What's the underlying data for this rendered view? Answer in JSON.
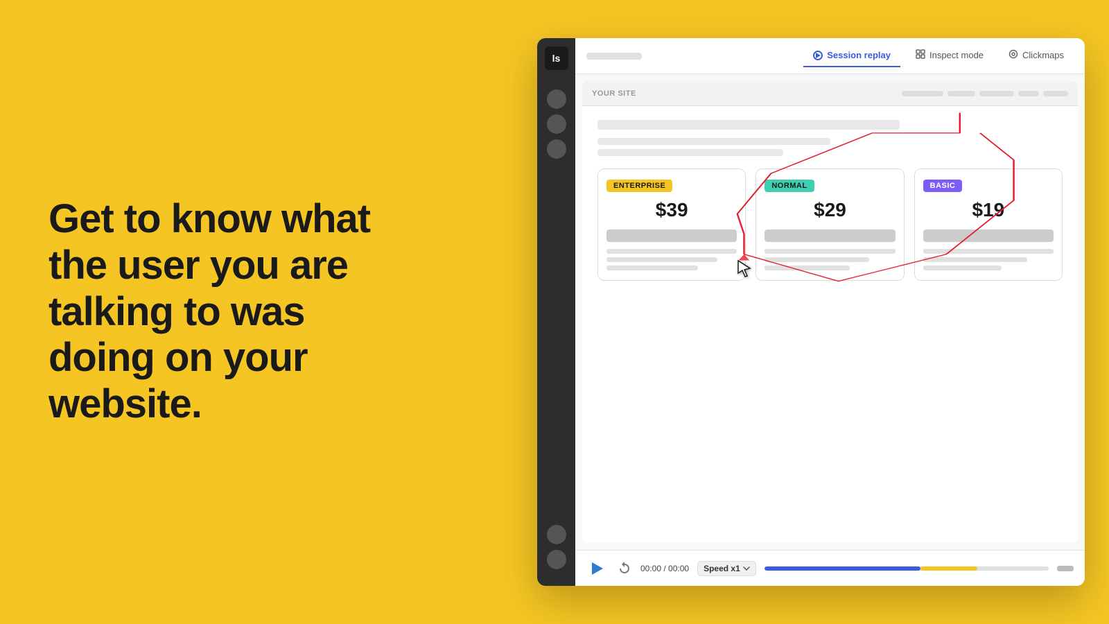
{
  "left": {
    "hero_line1": "Get to know what",
    "hero_line2": "the user you are",
    "hero_line3": "talking to was",
    "hero_line4": "doing on your",
    "hero_line5": "website."
  },
  "app": {
    "logo_text": "ls",
    "tabs": [
      {
        "id": "session-replay",
        "label": "Session replay",
        "active": true
      },
      {
        "id": "inspect-mode",
        "label": "Inspect mode",
        "active": false
      },
      {
        "id": "clickmaps",
        "label": "Clickmaps",
        "active": false
      }
    ],
    "browser": {
      "site_label": "YOUR SITE"
    },
    "pricing_cards": [
      {
        "badge": "ENTERPRISE",
        "badge_type": "enterprise",
        "price": "$39"
      },
      {
        "badge": "NORMAL",
        "badge_type": "normal",
        "price": "$29"
      },
      {
        "badge": "BASIC",
        "badge_type": "basic",
        "price": "$19"
      }
    ],
    "player": {
      "time": "00:00 / 00:00",
      "speed_label": "Speed x1"
    }
  }
}
